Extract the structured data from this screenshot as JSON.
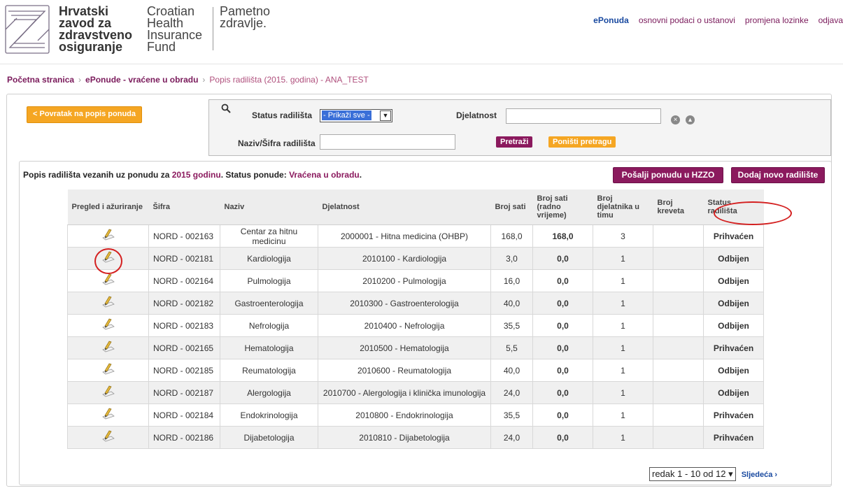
{
  "brand": {
    "hr_lines": [
      "Hrvatski",
      "zavod za",
      "zdravstveno",
      "osiguranje"
    ],
    "en_lines": [
      "Croatian",
      "Health",
      "Insurance",
      "Fund"
    ],
    "slogan_lines": [
      "Pametno",
      "zdravlje."
    ]
  },
  "topnav": [
    "ePonuda",
    "osnovni podaci o ustanovi",
    "promjena lozinke",
    "odjava"
  ],
  "breadcrumb": {
    "home": "Početna stranica",
    "level2": "ePonude - vraćene u obradu",
    "current": "Popis radilišta (2015. godina) - ANA_TEST",
    "separator": "›"
  },
  "back_button": "< Povratak na popis ponuda",
  "search": {
    "status_label": "Status radilišta",
    "status_value": "- Prikaži sve -",
    "djelatnost_label": "Djelatnost",
    "djelatnost_value": "",
    "naziv_label": "Naziv/Šifra radilišta",
    "naziv_value": "",
    "search_button": "Pretraži",
    "reset_button": "Poništi pretragu"
  },
  "caption": {
    "prefix": "Popis radilišta vezanih uz ponudu za ",
    "year": "2015 godinu",
    "middle": ". Status ponude: ",
    "status": "Vraćena u obradu",
    "suffix": "."
  },
  "actions": {
    "send": "Pošalji ponudu u HZZO",
    "add": "Dodaj novo radilište"
  },
  "columns": [
    "Pregled i ažuriranje",
    "Šifra",
    "Naziv",
    "Djelatnost",
    "Broj sati",
    "Broj sati (radno vrijeme)",
    "Broj djelatnika u timu",
    "Broj kreveta",
    "Status radilišta"
  ],
  "rows": [
    {
      "sifra": "NORD - 002163",
      "naziv": "Centar za hitnu medicinu",
      "djelatnost": "2000001 - Hitna medicina (OHBP)",
      "sati": "168,0",
      "radno": "168,0",
      "djelatnici": "3",
      "kreveti": "",
      "status": "Prihvaćen"
    },
    {
      "sifra": "NORD - 002181",
      "naziv": "Kardiologija",
      "djelatnost": "2010100 - Kardiologija",
      "sati": "3,0",
      "radno": "0,0",
      "djelatnici": "1",
      "kreveti": "",
      "status": "Odbijen"
    },
    {
      "sifra": "NORD - 002164",
      "naziv": "Pulmologija",
      "djelatnost": "2010200 - Pulmologija",
      "sati": "16,0",
      "radno": "0,0",
      "djelatnici": "1",
      "kreveti": "",
      "status": "Odbijen"
    },
    {
      "sifra": "NORD - 002182",
      "naziv": "Gastroenterologija",
      "djelatnost": "2010300 - Gastroenterologija",
      "sati": "40,0",
      "radno": "0,0",
      "djelatnici": "1",
      "kreveti": "",
      "status": "Odbijen"
    },
    {
      "sifra": "NORD - 002183",
      "naziv": "Nefrologija",
      "djelatnost": "2010400 - Nefrologija",
      "sati": "35,5",
      "radno": "0,0",
      "djelatnici": "1",
      "kreveti": "",
      "status": "Odbijen"
    },
    {
      "sifra": "NORD - 002165",
      "naziv": "Hematologija",
      "djelatnost": "2010500 - Hematologija",
      "sati": "5,5",
      "radno": "0,0",
      "djelatnici": "1",
      "kreveti": "",
      "status": "Prihvaćen"
    },
    {
      "sifra": "NORD - 002185",
      "naziv": "Reumatologija",
      "djelatnost": "2010600 - Reumatologija",
      "sati": "40,0",
      "radno": "0,0",
      "djelatnici": "1",
      "kreveti": "",
      "status": "Odbijen"
    },
    {
      "sifra": "NORD - 002187",
      "naziv": "Alergologija",
      "djelatnost": "2010700 - Alergologija i klinička imunologija",
      "sati": "24,0",
      "radno": "0,0",
      "djelatnici": "1",
      "kreveti": "",
      "status": "Odbijen"
    },
    {
      "sifra": "NORD - 002184",
      "naziv": "Endokrinologija",
      "djelatnost": "2010800 - Endokrinologija",
      "sati": "35,5",
      "radno": "0,0",
      "djelatnici": "1",
      "kreveti": "",
      "status": "Prihvaćen"
    },
    {
      "sifra": "NORD - 002186",
      "naziv": "Dijabetologija",
      "djelatnost": "2010810 - Dijabetologija",
      "sati": "24,0",
      "radno": "0,0",
      "djelatnici": "1",
      "kreveti": "",
      "status": "Prihvaćen"
    }
  ],
  "pager": {
    "range": "redak 1 - 10 od 12",
    "next": "Sljedeća ›"
  },
  "colors": {
    "accent_purple": "#8b1a5e",
    "accent_orange": "#f5a623",
    "accepted": "#2a8a2a",
    "rejected": "#d61e1e",
    "annotation_red": "#d42020"
  },
  "icons": {
    "logo": "hzzo-logo-icon",
    "search": "search-icon",
    "edit": "edit-pencil-icon",
    "clear": "clear-icon",
    "collapse": "collapse-icon"
  }
}
